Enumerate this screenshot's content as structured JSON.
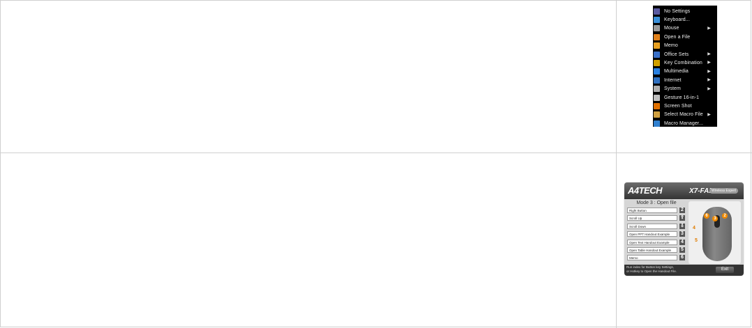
{
  "menu": {
    "items": [
      {
        "label": "No Settings",
        "icon": "no-settings-icon",
        "color": "#5a5aa0",
        "arrow": ""
      },
      {
        "label": "Keyboard...",
        "icon": "keyboard-icon",
        "color": "#3a8fd8",
        "arrow": ""
      },
      {
        "label": "Mouse",
        "icon": "mouse-icon",
        "color": "#9a9a9a",
        "arrow": "▶"
      },
      {
        "label": "Open a File",
        "icon": "open-file-icon",
        "color": "#e0801a",
        "arrow": ""
      },
      {
        "label": "Memo",
        "icon": "memo-icon",
        "color": "#e8a020",
        "arrow": ""
      },
      {
        "label": "Office Sets",
        "icon": "office-sets-icon",
        "color": "#3a70c8",
        "arrow": "▶"
      },
      {
        "label": "Key Combination",
        "icon": "key-combination-icon",
        "color": "#d0a000",
        "arrow": "▶"
      },
      {
        "label": "Multimedia",
        "icon": "multimedia-icon",
        "color": "#2a80e0",
        "arrow": "▶"
      },
      {
        "label": "Internet",
        "icon": "internet-icon",
        "color": "#3070c0",
        "arrow": "▶"
      },
      {
        "label": "System",
        "icon": "system-icon",
        "color": "#b0b0b0",
        "arrow": "▶"
      },
      {
        "label": "Gesture 16-in-1",
        "icon": "gesture-icon",
        "color": "#c0c0c0",
        "arrow": ""
      },
      {
        "label": "Screen Shot",
        "icon": "screen-shot-icon",
        "color": "#e07000",
        "arrow": ""
      },
      {
        "label": "Select Macro File",
        "icon": "macro-file-icon",
        "color": "#d0a040",
        "arrow": "▶"
      },
      {
        "label": "Macro Manager...",
        "icon": "macro-manager-icon",
        "color": "#3080d0",
        "arrow": ""
      }
    ]
  },
  "panel": {
    "logo": "A4TECH",
    "brand": "X7-FAR",
    "brand_sub": "Wireless Expert",
    "mode_title": "Mode 3 : Open file",
    "rows": [
      {
        "label": "Right Button",
        "num": "2"
      },
      {
        "label": "Scroll Up",
        "num": "⇧"
      },
      {
        "label": "Scroll Down",
        "num": "⇩"
      },
      {
        "label": "Open PPT Handout Example",
        "num": "3"
      },
      {
        "label": "Open Text Handout Example",
        "num": "4"
      },
      {
        "label": "Open Table Handout Example",
        "num": "5"
      },
      {
        "label": "Memo",
        "num": "6"
      }
    ],
    "footer_text": "Run index for Button key Settings,\nor Hotkey to Open the Handout File.",
    "exit_label": "Exit",
    "accent": "#f08a00"
  }
}
